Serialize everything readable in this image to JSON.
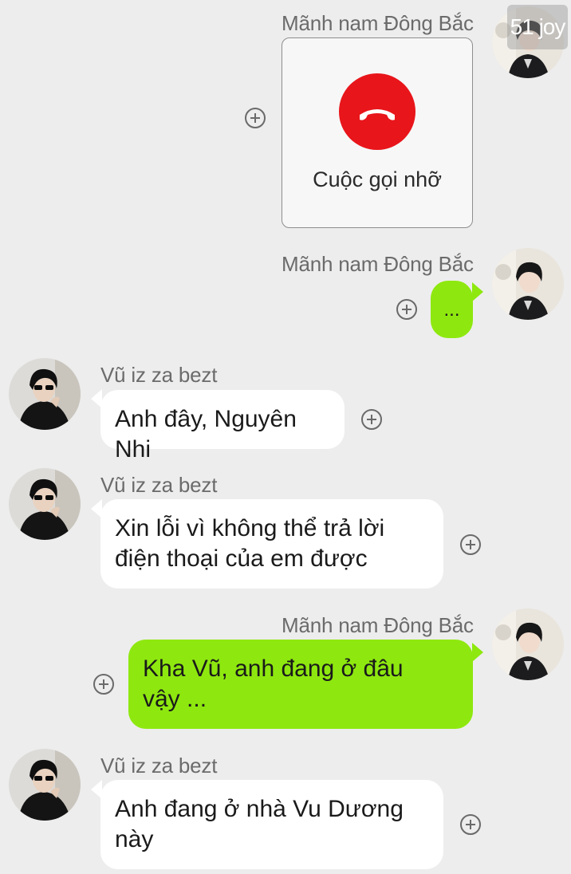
{
  "messages": [
    {
      "sender": "Mãnh nam Đông Bắc",
      "type": "missed-call",
      "text": "Cuộc gọi nhỡ"
    },
    {
      "sender": "Mãnh nam Đông Bắc",
      "type": "text",
      "text": "..."
    },
    {
      "sender": "Vũ iz za bezt",
      "type": "text",
      "text": "Anh đây, Nguyên Nhi"
    },
    {
      "sender": "Vũ iz za bezt",
      "type": "text",
      "lines": [
        "Xin lỗi vì không thể trả lời",
        "điện thoại của em được"
      ]
    },
    {
      "sender": "Mãnh nam Đông Bắc",
      "type": "text",
      "lines": [
        "Kha Vũ, anh đang ở đâu",
        "vậy ..."
      ]
    },
    {
      "sender": "Vũ iz za bezt",
      "type": "text",
      "lines": [
        "Anh đang ở nhà Vu Dương",
        "này"
      ]
    }
  ],
  "watermark": "51 joy",
  "colors": {
    "background": "#ededed",
    "outgoing_bubble": "#8ee80f",
    "incoming_bubble": "#ffffff",
    "missed_call": "#e8151b"
  },
  "icons": {
    "add": "plus-circle-icon",
    "call": "phone-hangup-icon"
  }
}
